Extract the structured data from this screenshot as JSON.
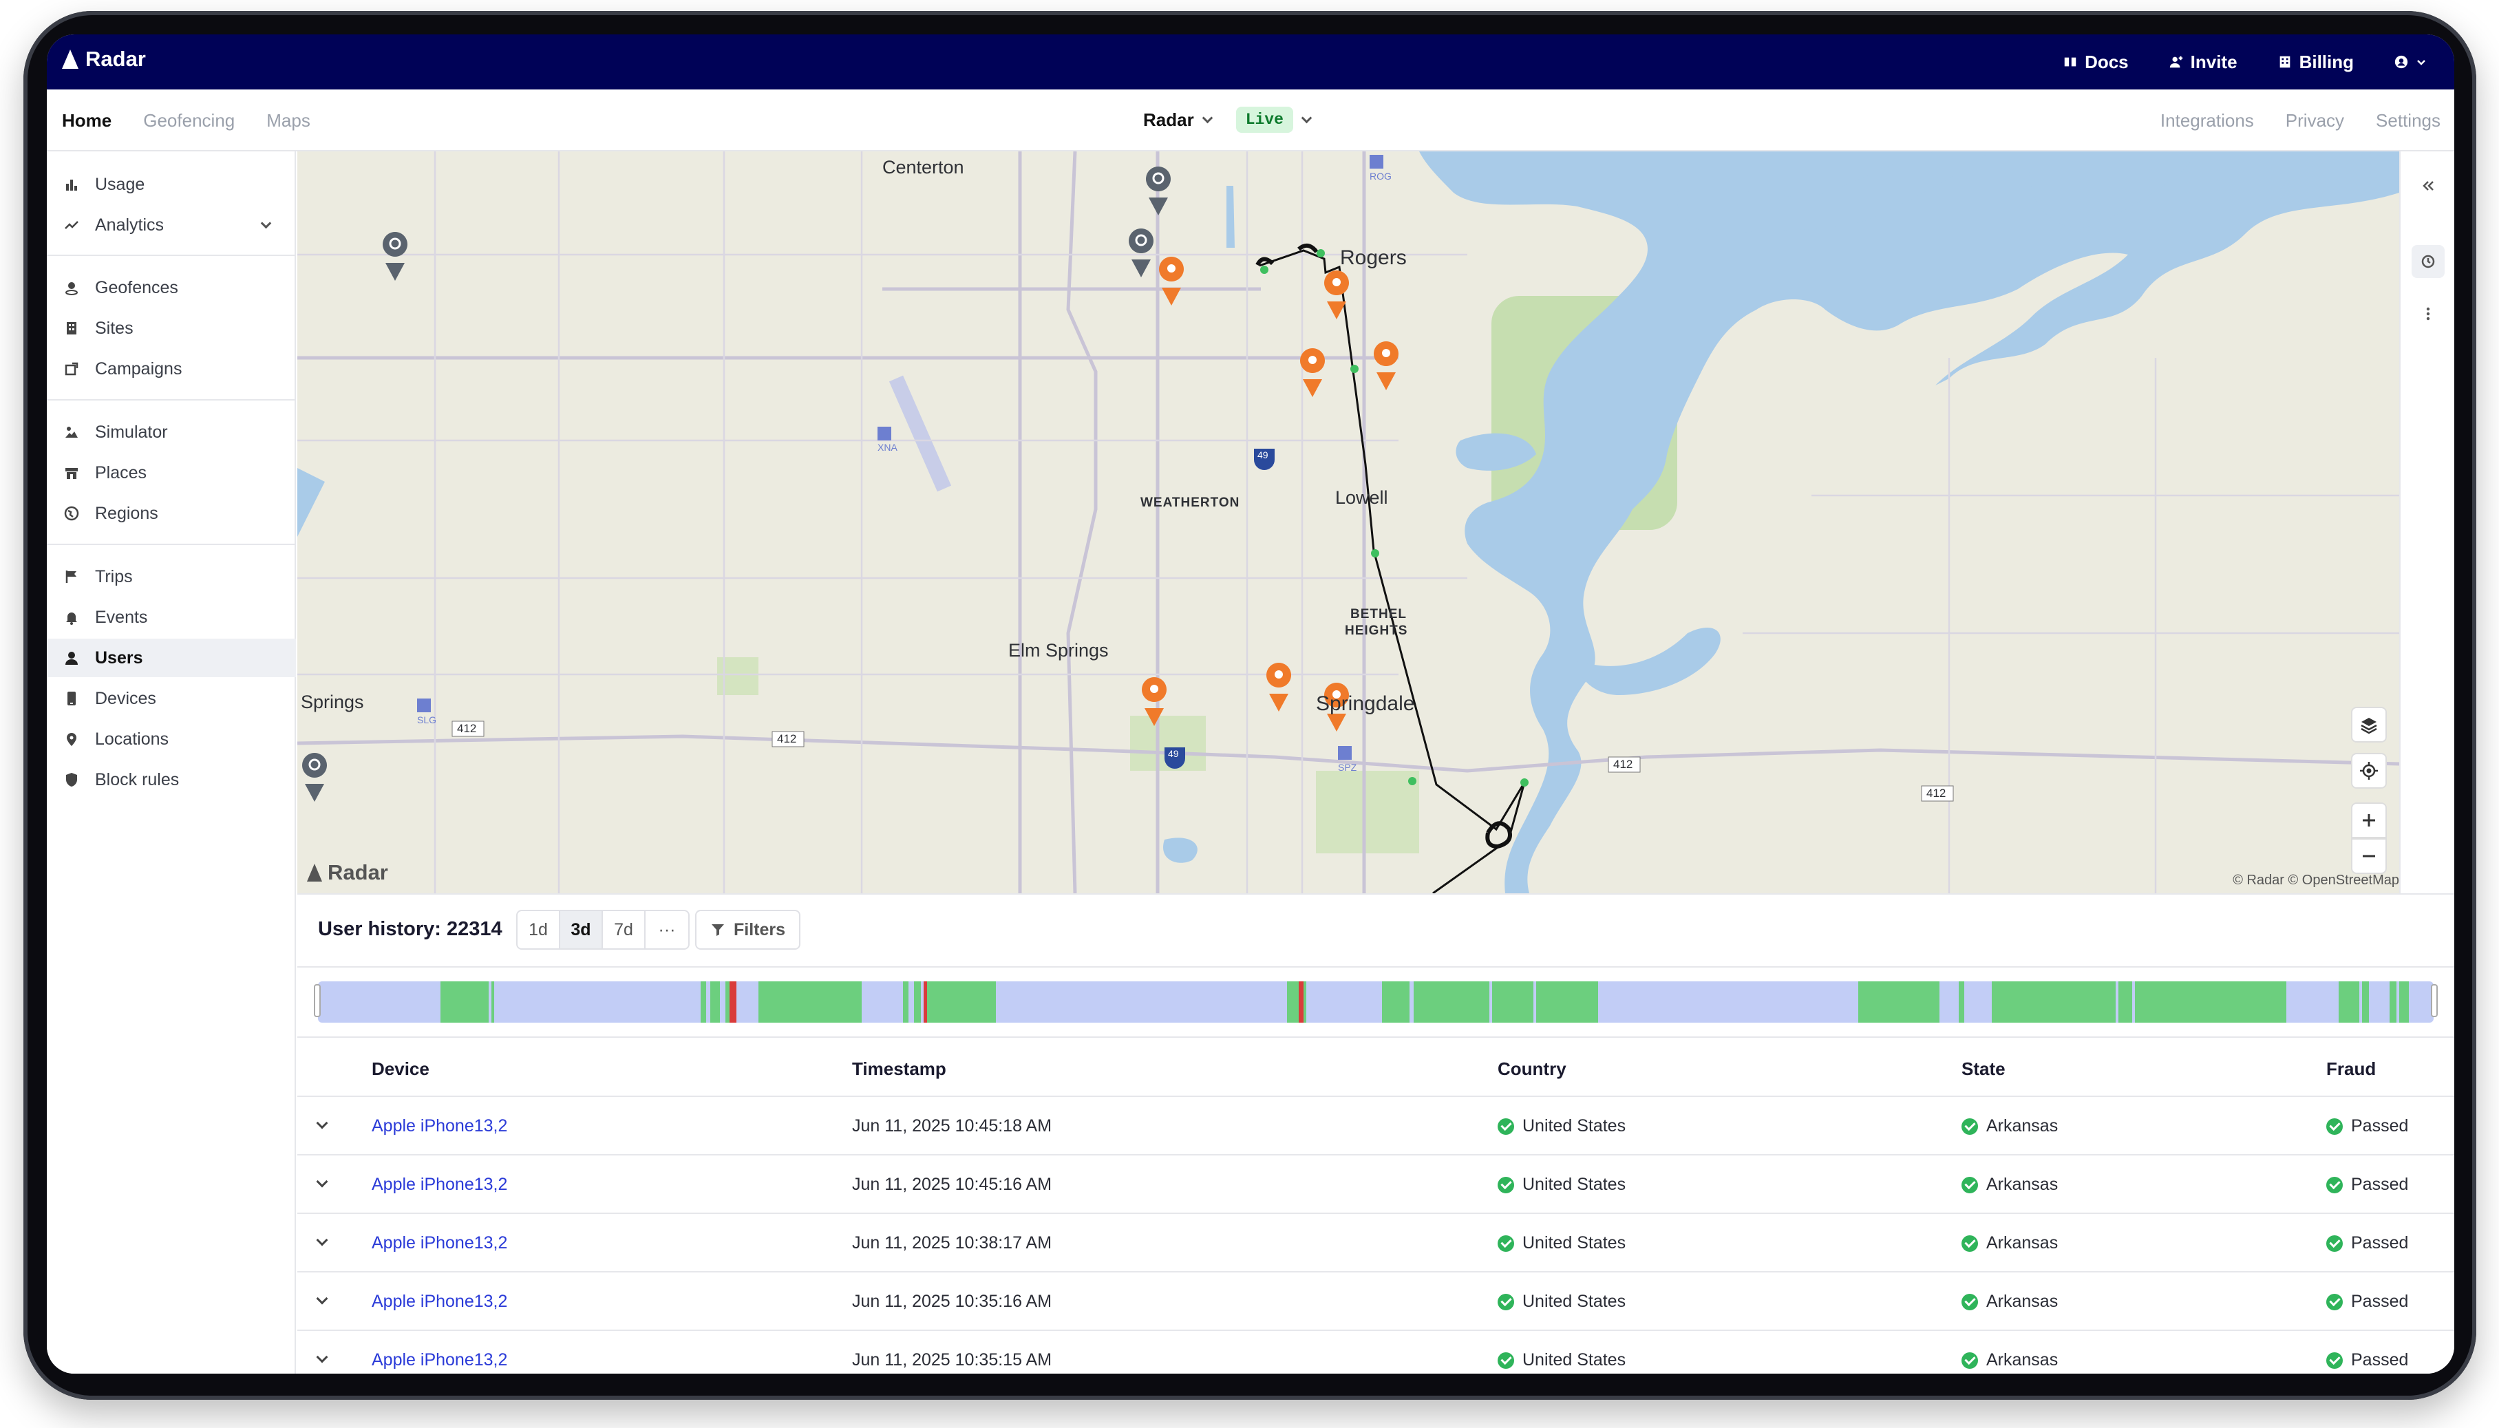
{
  "app": {
    "name": "Radar"
  },
  "topbar": {
    "actions": [
      {
        "label": "Docs",
        "icon": "book-icon"
      },
      {
        "label": "Invite",
        "icon": "add-user-icon"
      },
      {
        "label": "Billing",
        "icon": "building-icon"
      }
    ],
    "account_icon": "account-icon"
  },
  "navbar": {
    "tabs": [
      {
        "label": "Home",
        "active": true
      },
      {
        "label": "Geofencing",
        "active": false
      },
      {
        "label": "Maps",
        "active": false
      }
    ],
    "project": "Radar",
    "environment": "Live",
    "right_links": [
      "Integrations",
      "Privacy",
      "Settings"
    ]
  },
  "sidebar": {
    "items": [
      {
        "label": "Usage",
        "icon": "bar-chart-icon"
      },
      {
        "label": "Analytics",
        "icon": "trend-icon",
        "expandable": true
      },
      {
        "label": "Geofences",
        "icon": "geofence-icon"
      },
      {
        "label": "Sites",
        "icon": "building-icon"
      },
      {
        "label": "Campaigns",
        "icon": "campaign-icon"
      },
      {
        "label": "Simulator",
        "icon": "simulator-icon"
      },
      {
        "label": "Places",
        "icon": "store-icon"
      },
      {
        "label": "Regions",
        "icon": "globe-icon"
      },
      {
        "label": "Trips",
        "icon": "flag-icon"
      },
      {
        "label": "Events",
        "icon": "bell-icon"
      },
      {
        "label": "Users",
        "icon": "user-icon",
        "active": true
      },
      {
        "label": "Devices",
        "icon": "phone-icon"
      },
      {
        "label": "Locations",
        "icon": "pin-icon"
      },
      {
        "label": "Block rules",
        "icon": "shield-icon"
      }
    ]
  },
  "map": {
    "labels": {
      "centerton": "Centerton",
      "rogers": "Rogers",
      "weatherton": "WEATHERTON",
      "lowell": "Lowell",
      "bethel1": "BETHEL",
      "bethel2": "HEIGHTS",
      "elm_springs": "Elm Springs",
      "springs": "Springs",
      "springdale": "Springdale",
      "xna": "XNA",
      "slg": "SLG",
      "spz": "SPZ",
      "rog": "ROG",
      "hwy412": "412",
      "hwy49": "49"
    },
    "watermark": "Radar",
    "attribution": "© Radar © OpenStreetMap",
    "colors": {
      "land": "#ecebe0",
      "water": "#a9cbe8",
      "park": "#c6deb0",
      "event_pin": "#f07a2a",
      "geofence_pin": "#5a636e"
    }
  },
  "history": {
    "title": "User history: 22314",
    "ranges": [
      {
        "label": "1d",
        "selected": false
      },
      {
        "label": "3d",
        "selected": true
      },
      {
        "label": "7d",
        "selected": false
      },
      {
        "label": "···",
        "selected": false
      }
    ],
    "filters_label": "Filters",
    "timeline_colors": {
      "idle": "#c2cdf6",
      "active": "#6ccf7e",
      "alert": "#d93b3b"
    },
    "columns": [
      "Device",
      "Timestamp",
      "Country",
      "State",
      "Fraud"
    ],
    "rows": [
      {
        "device": "Apple iPhone13,2",
        "timestamp": "Jun 11, 2025 10:45:18 AM",
        "country": "United States",
        "state": "Arkansas",
        "fraud": "Passed"
      },
      {
        "device": "Apple iPhone13,2",
        "timestamp": "Jun 11, 2025 10:45:16 AM",
        "country": "United States",
        "state": "Arkansas",
        "fraud": "Passed"
      },
      {
        "device": "Apple iPhone13,2",
        "timestamp": "Jun 11, 2025 10:38:17 AM",
        "country": "United States",
        "state": "Arkansas",
        "fraud": "Passed"
      },
      {
        "device": "Apple iPhone13,2",
        "timestamp": "Jun 11, 2025 10:35:16 AM",
        "country": "United States",
        "state": "Arkansas",
        "fraud": "Passed"
      },
      {
        "device": "Apple iPhone13,2",
        "timestamp": "Jun 11, 2025 10:35:15 AM",
        "country": "United States",
        "state": "Arkansas",
        "fraud": "Passed"
      }
    ]
  }
}
